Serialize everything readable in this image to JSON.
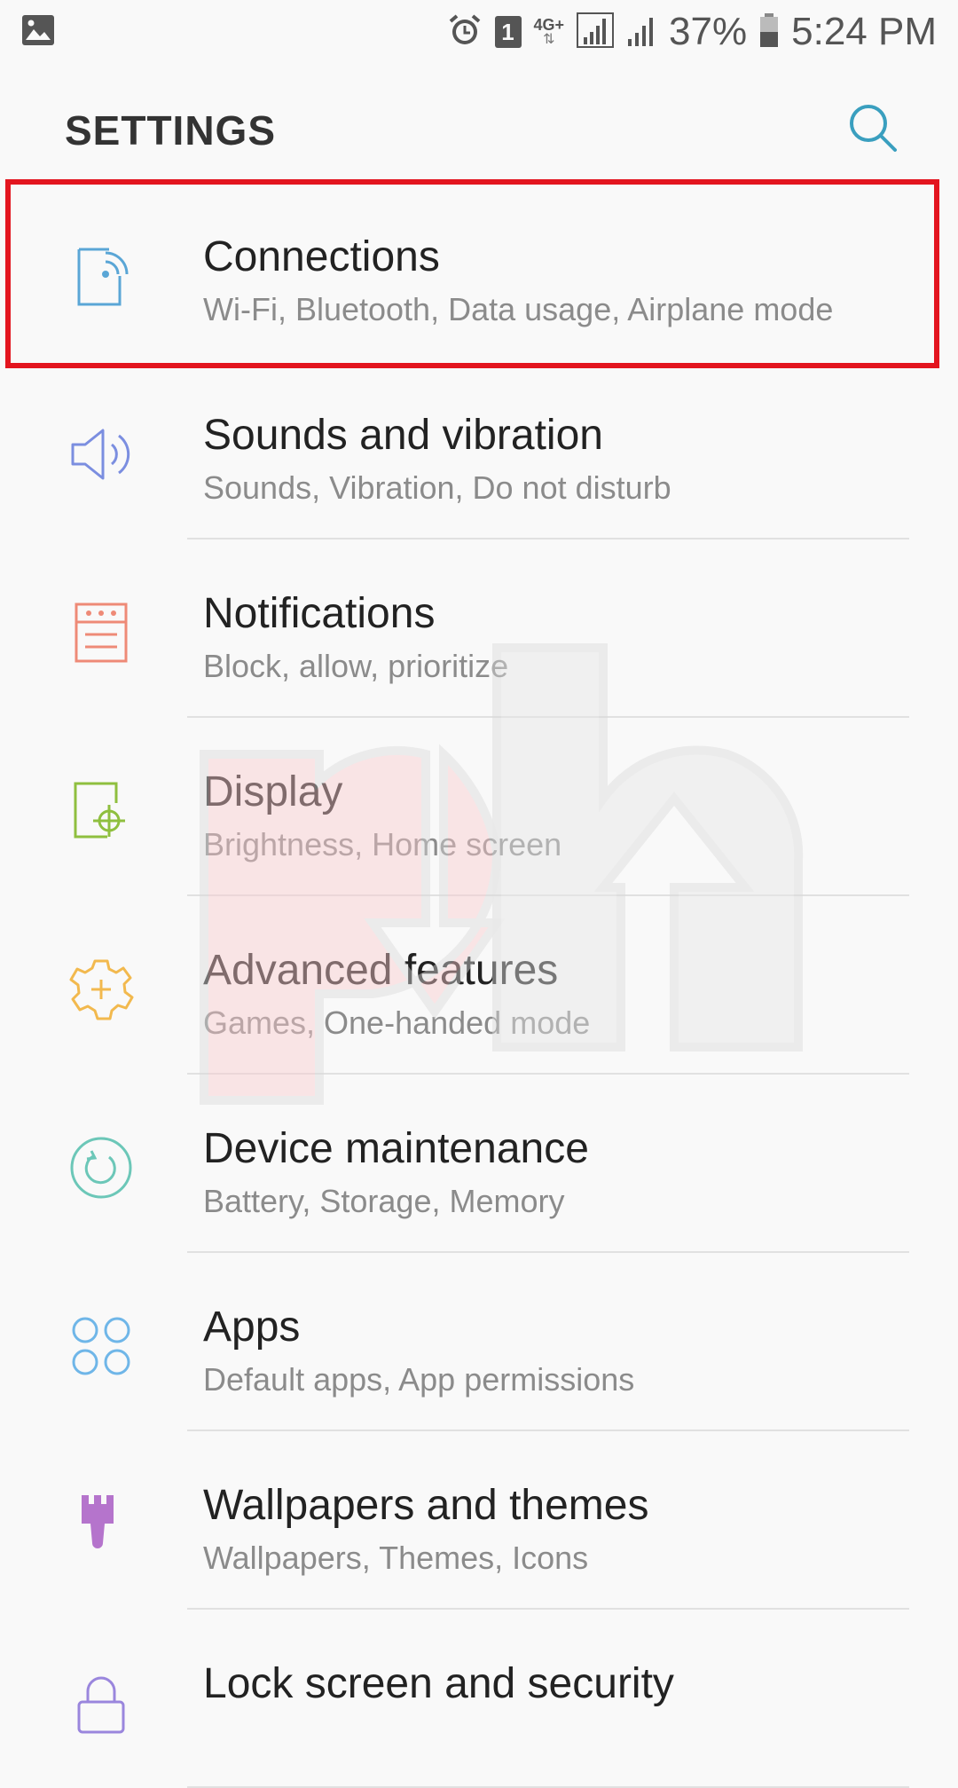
{
  "status_bar": {
    "sim_slot": "1",
    "network_label": "4G+",
    "battery_percent": "37%",
    "time": "5:24 PM",
    "icons": [
      "gallery-icon",
      "alarm-icon",
      "sim-icon",
      "network-icon",
      "signal-icon",
      "signal-icon-2",
      "battery-icon"
    ]
  },
  "header": {
    "title": "SETTINGS",
    "search_icon": "search-icon"
  },
  "colors": {
    "highlight": "#e3151f",
    "connections_icon": "#5aa6d6",
    "sounds_icon": "#7b8ee0",
    "notifications_icon": "#ee8a77",
    "display_icon": "#8fbf3f",
    "advanced_icon": "#f2b94e",
    "maintenance_icon": "#6cc7b8",
    "apps_icon": "#6fb6e8",
    "wallpapers_icon": "#b574cc",
    "lock_icon": "#9a86dd"
  },
  "items": [
    {
      "title": "Connections",
      "subtitle": "Wi-Fi, Bluetooth, Data usage, Airplane mode",
      "icon": "connections-icon"
    },
    {
      "title": "Sounds and vibration",
      "subtitle": "Sounds, Vibration, Do not disturb",
      "icon": "speaker-icon"
    },
    {
      "title": "Notifications",
      "subtitle": "Block, allow, prioritize",
      "icon": "notifications-icon"
    },
    {
      "title": "Display",
      "subtitle": "Brightness, Home screen",
      "icon": "display-icon"
    },
    {
      "title": "Advanced features",
      "subtitle": "Games, One-handed mode",
      "icon": "gear-plus-icon"
    },
    {
      "title": "Device maintenance",
      "subtitle": "Battery, Storage, Memory",
      "icon": "maintenance-icon"
    },
    {
      "title": "Apps",
      "subtitle": "Default apps, App permissions",
      "icon": "apps-icon"
    },
    {
      "title": "Wallpapers and themes",
      "subtitle": "Wallpapers, Themes, Icons",
      "icon": "brush-icon"
    },
    {
      "title": "Lock screen and security",
      "subtitle": "",
      "icon": "lock-icon"
    }
  ]
}
